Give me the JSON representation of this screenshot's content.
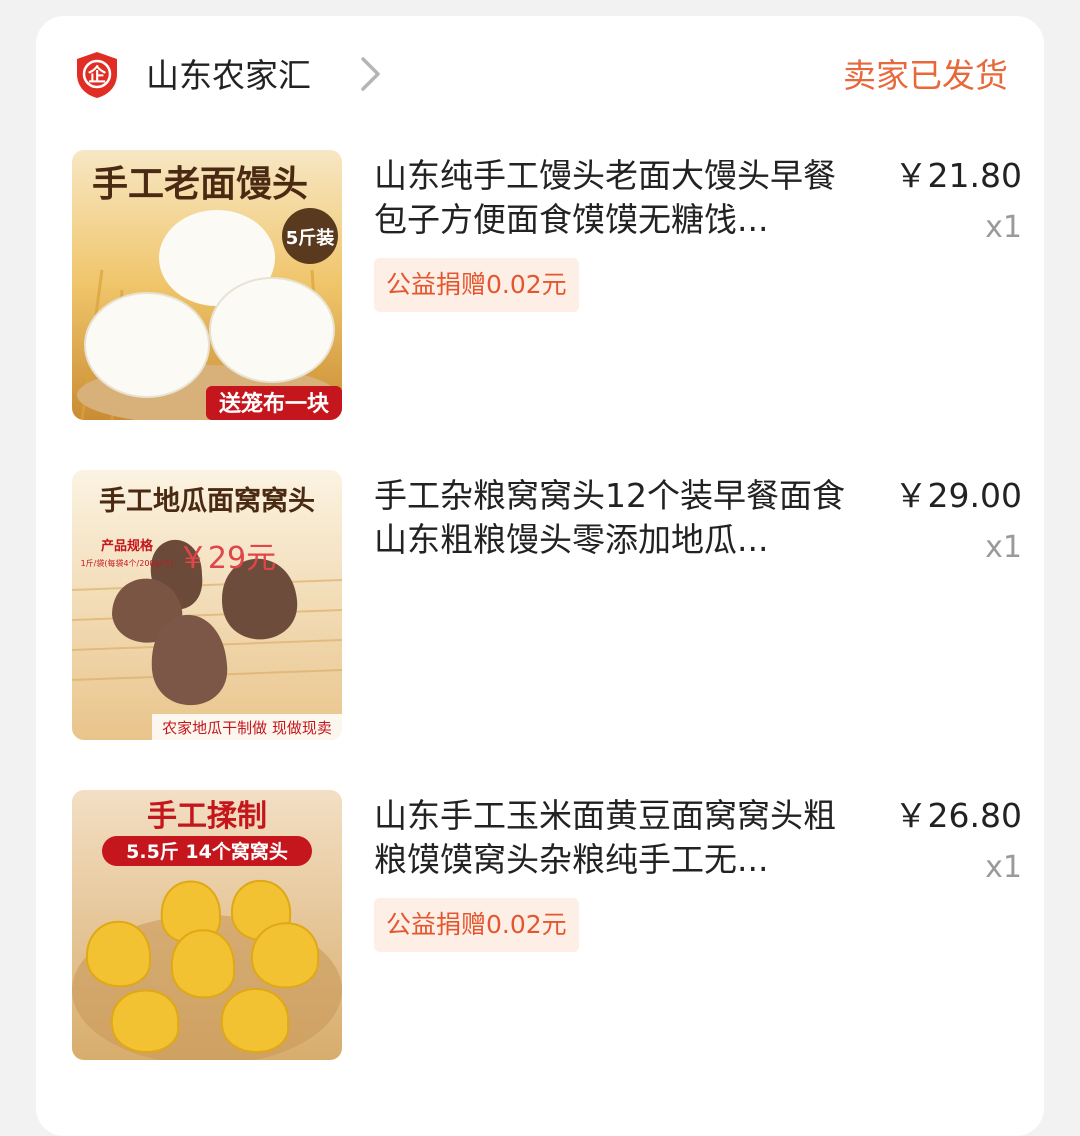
{
  "shop": {
    "badge_icon": "enterprise-shield-icon",
    "badge_text": "企",
    "name": "山东农家汇",
    "status": "卖家已发货",
    "status_color": "#e8683a"
  },
  "items": [
    {
      "title": "山东纯手工馒头老面大馒头早餐包子方便面食馍馍无糖饯...",
      "price": "￥21.80",
      "qty": "x1",
      "donation": "公益捐赠0.02元",
      "image": {
        "headline": "手工老面馒头",
        "badge": "5斤装",
        "footer": "送笼布一块"
      }
    },
    {
      "title": "手工杂粮窝窝头12个装早餐面食山东粗粮馒头零添加地瓜...",
      "price": "￥29.00",
      "qty": "x1",
      "donation": "",
      "image": {
        "headline": "手工地瓜面窝窝头",
        "spec_label": "产品规格",
        "spec_detail": "1斤/袋(每袋4个/200g/个)",
        "price_tag": "￥29元",
        "footer": "农家地瓜干制做 现做现卖"
      }
    },
    {
      "title": "山东手工玉米面黄豆面窝窝头粗粮馍馍窝头杂粮纯手工无...",
      "price": "￥26.80",
      "qty": "x1",
      "donation": "公益捐赠0.02元",
      "image": {
        "headline": "手工揉制",
        "subline": "5.5斤 14个窝窝头"
      }
    }
  ]
}
